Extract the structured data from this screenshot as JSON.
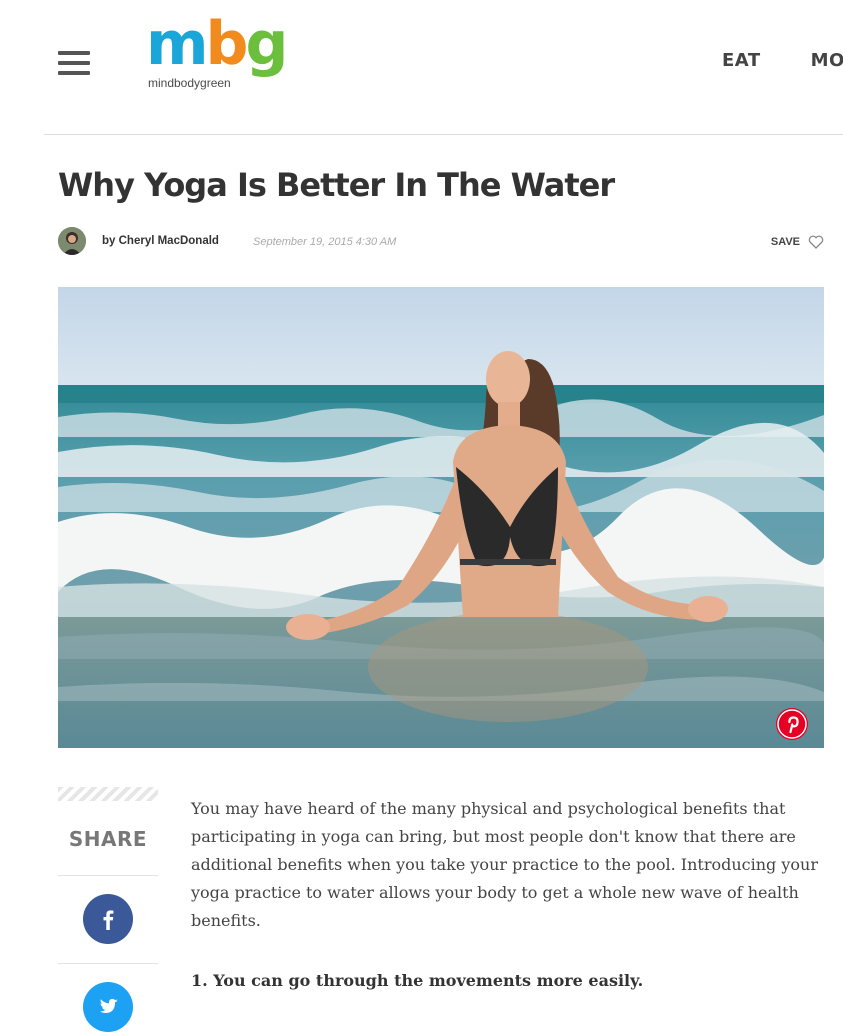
{
  "header": {
    "logo_text": [
      "m",
      "b",
      "g"
    ],
    "logo_sub": "mindbodygreen",
    "nav": [
      "EAT",
      "MOVE"
    ]
  },
  "article": {
    "title": "Why Yoga Is Better In The Water",
    "author": "by Cheryl MacDonald",
    "date": "September 19, 2015 4:30 AM",
    "save_label": "SAVE",
    "paragraph_1": "You may have heard of the many physical and psychological benefits that participating in yoga can bring, but most people don't know that there are additional benefits when you take your practice to the pool. Introducing your yoga practice to water allows your body to get a whole new wave of health benefits.",
    "subheading_1": "1. You can go through the movements more easily."
  },
  "share": {
    "label": "SHARE",
    "facebook_icon": "facebook-icon",
    "twitter_icon": "twitter-icon"
  },
  "colors": {
    "logo_m": "#1ba6d9",
    "logo_b": "#f28b1e",
    "logo_g": "#6cbf3c",
    "facebook": "#3b5998",
    "twitter": "#1da1f2",
    "pinterest": "#e60023"
  }
}
